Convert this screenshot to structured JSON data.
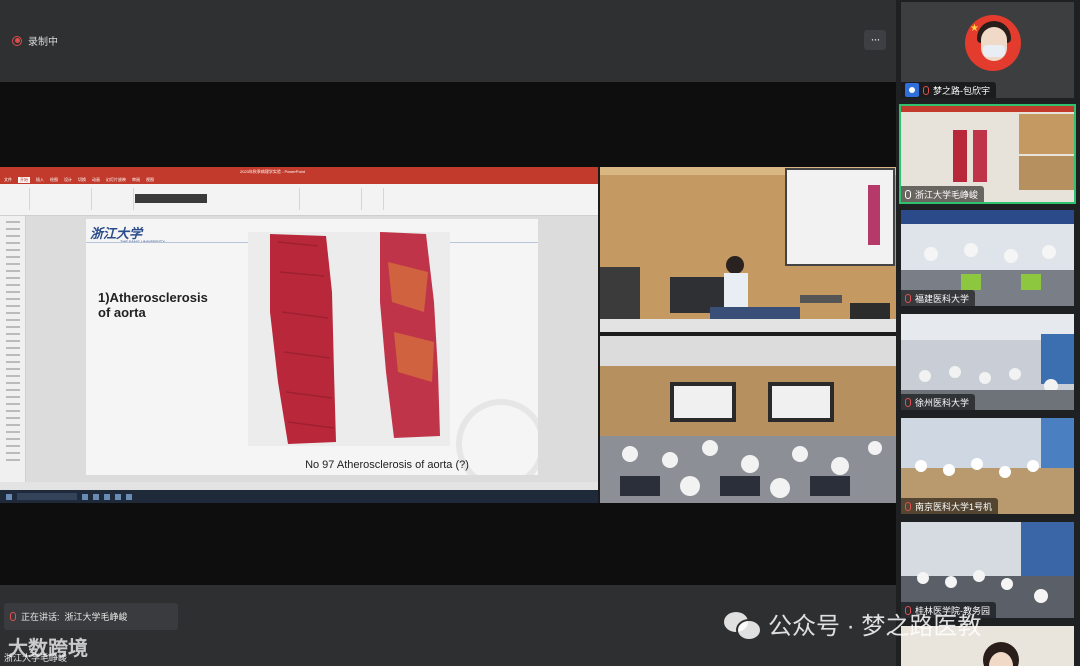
{
  "recording": {
    "label": "录制中"
  },
  "topbar": {
    "more_label": "···"
  },
  "ppt": {
    "window_title": "2023年秋季病理学实验 - PowerPoint",
    "tabs": [
      "文件",
      "开始",
      "插入",
      "绘图",
      "设计",
      "切换",
      "动画",
      "幻灯片放映",
      "审阅",
      "视图"
    ],
    "slide_logo": "浙江大学",
    "slide_logo_sub": "ZHEJIANG UNIVERSITY",
    "slide_heading": "1)Atherosclerosis\nof aorta",
    "slide_caption": "No 97 Atherosclerosis of aorta (?)"
  },
  "participants": [
    {
      "name": "梦之路-包欣宇",
      "mic": "red",
      "has_user_badge": true
    },
    {
      "name": "浙江大学毛峥峻",
      "mic": "white",
      "active": true
    },
    {
      "name": "福建医科大学",
      "mic": "red"
    },
    {
      "name": "徐州医科大学",
      "mic": "red"
    },
    {
      "name": "南京医科大学1号机",
      "mic": "red"
    },
    {
      "name": "桂林医学院-教务园",
      "mic": "red"
    }
  ],
  "speaking": {
    "label": "正在讲话:",
    "name": "浙江大学毛峥峻"
  },
  "bottom_label": {
    "name": "浙江大学毛峥峻"
  },
  "watermarks": {
    "left": "大数跨境",
    "right": "公众号 · 梦之路医教"
  },
  "colors": {
    "active_border": "#2fc16d",
    "recording": "#e04b4b",
    "ppt_red": "#c23a2b"
  }
}
